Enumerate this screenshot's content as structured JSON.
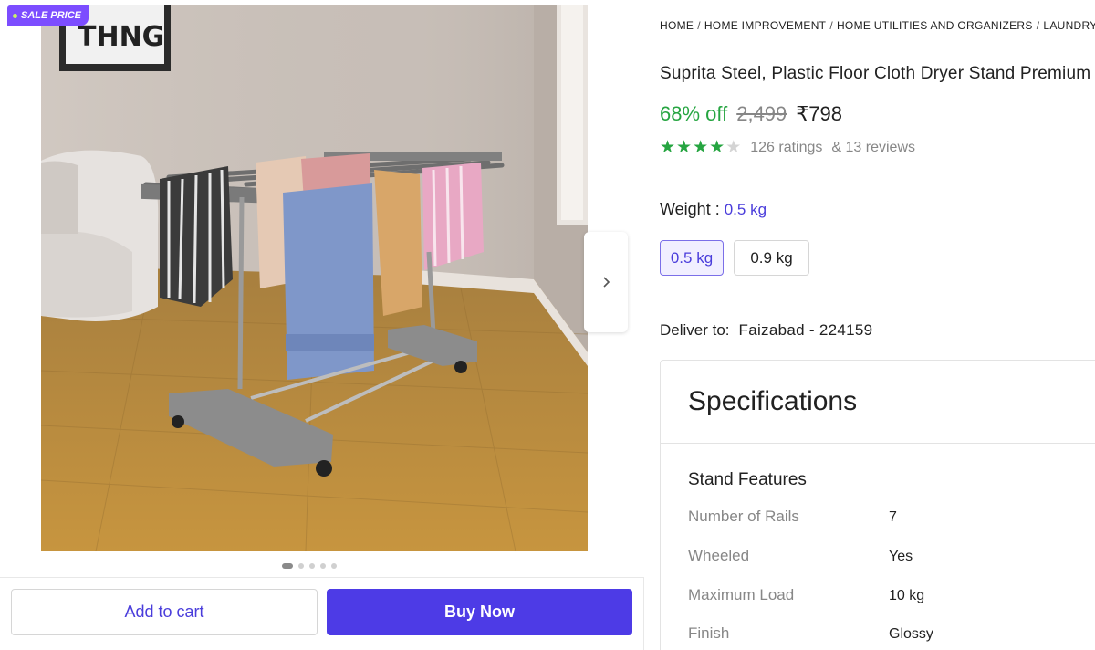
{
  "badge": {
    "label": "SALE PRICE"
  },
  "gallery": {
    "image_count": 5,
    "active_index": 0
  },
  "actions": {
    "add_to_cart": "Add to cart",
    "buy_now": "Buy Now"
  },
  "breadcrumb": [
    "HOME",
    "HOME IMPROVEMENT",
    "HOME UTILITIES AND ORGANIZERS",
    "LAUNDRY"
  ],
  "product": {
    "title": "Suprita Steel, Plastic Floor Cloth Dryer Stand Premium",
    "discount": "68% off",
    "mrp": "2,499",
    "price": "₹798",
    "rating_value": 4,
    "rating_max": 5,
    "ratings_text": "126 ratings",
    "reviews_text": "& 13 reviews"
  },
  "weight": {
    "label": "Weight :",
    "selected": "0.5 kg",
    "options": [
      "0.5 kg",
      "0.9 kg"
    ]
  },
  "delivery": {
    "label": "Deliver to:",
    "location": "Faizabad - 224159"
  },
  "specs": {
    "heading": "Specifications",
    "section": "Stand Features",
    "rows": [
      {
        "key": "Number of Rails",
        "value": "7"
      },
      {
        "key": "Wheeled",
        "value": "Yes"
      },
      {
        "key": "Maximum Load",
        "value": "10 kg"
      },
      {
        "key": "Finish",
        "value": "Glossy"
      }
    ]
  },
  "colors": {
    "accent": "#4d3be6",
    "discount": "#26a541",
    "badge": "#7c4dff"
  }
}
